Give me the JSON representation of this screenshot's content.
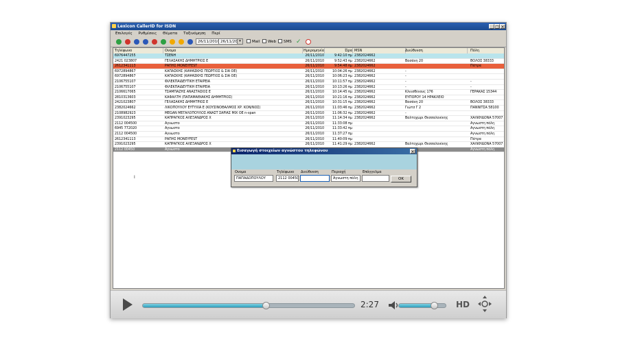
{
  "window": {
    "title": "Lexicon CallerID for ISDN",
    "buttons": {
      "minimize": "_",
      "maximize": "□",
      "close": "×"
    }
  },
  "menu": [
    "Επιλογές",
    "Ρυθμίσεις",
    "Θέματα",
    "Ταξινόμηση",
    "Περί"
  ],
  "toolbar": {
    "date_from": "26/11/2010",
    "date_to": "26/11/2010",
    "checks": [
      "Mail",
      "Web",
      "SMS"
    ],
    "icon_colors": [
      "#2ea043",
      "#d0342c",
      "#2b58b8",
      "#2b58b8",
      "#d0342c",
      "#2ea043",
      "#f2a900",
      "#f2a900",
      "#2b58b8"
    ]
  },
  "table": {
    "columns": [
      "Τηλέφωνο",
      "Ονομα",
      "Ημερομηνία",
      "Ώρα",
      "MSN",
      "Διεύθυνση",
      "Πόλη"
    ],
    "rows": [
      {
        "cells": [
          "6976447255",
          "ΤΣΕΝΗ",
          "26/11/2010",
          "9:42:10 πμ",
          "2382024662",
          "",
          ""
        ],
        "style": "selected"
      },
      {
        "cells": [
          "2421 023807",
          "ΓΕΛΑΣΑΚΗΣ ΔΗΜΗΤΡΙΟΣ Ε",
          "26/11/2010",
          "9:52:43 πμ",
          "2382024662",
          "Βασάνη 20",
          "ΒΟΛΟΣ 38333"
        ],
        "style": ""
      },
      {
        "cells": [
          "2612341113",
          "ΡΑΠΗΣ MONEYFEST",
          "26/11/2010",
          "9:54:48 πμ",
          "2382024662",
          "",
          "Πάτρα"
        ],
        "style": "alert"
      },
      {
        "cells": [
          "6972894867",
          "ΚΑΠΑΣΚΗΣ (ΚΑΨΑΣΚΗΣ ΓΕΩΡΓΙΟΣ & ΣΙΑ ΟΕ)",
          "26/11/2010",
          "10:04:26 πμ",
          "2382024662",
          "-",
          ""
        ],
        "style": ""
      },
      {
        "cells": [
          "6972894867",
          "ΚΑΠΑΣΚΗΣ (ΚΑΨΑΣΚΗΣ ΓΕΩΡΓΙΟΣ & ΣΙΑ ΟΕ)",
          "26/11/2010",
          "10:06:23 πμ",
          "2382024662",
          "-",
          ""
        ],
        "style": ""
      },
      {
        "cells": [
          "2106755107",
          "ΦΙΛΕΚΠΑΙΔΕΥΤΙΚΗ ΕΤΑΙΡΕΙΑ",
          "26/11/2010",
          "10:11:57 πμ",
          "2382024662",
          "-",
          "-"
        ],
        "style": ""
      },
      {
        "cells": [
          "2106755107",
          "ΦΙΛΕΚΠΑΙΔΕΥΤΙΚΗ ΕΤΑΙΡΕΙΑ",
          "26/11/2010",
          "10:13:26 πμ",
          "2382024662",
          "-",
          "-"
        ],
        "style": ""
      },
      {
        "cells": [
          "2106617065",
          "ΤΣΑΜΠΑΖΗΣ ΑΝΑΣΤΑΣΙΟΣ Ε",
          "26/11/2010",
          "10:14:45 πμ",
          "2382024662",
          "Κλεισθένους 176",
          "ΓΕΡΑΚΑΣ 15344"
        ],
        "style": ""
      },
      {
        "cells": [
          "2810313603",
          "ΚΑΦΑΛΤΗ (ΠΑΠΑΜΑΘΙΑΚΗΣ ΔΗΜΗΤΡΙΟΣ)",
          "26/11/2010",
          "10:21:16 πμ",
          "2382024662",
          "ΕΥΠΟΡΟΥ 14 ΗΡΑΚΛΕΙΟ",
          ""
        ],
        "style": ""
      },
      {
        "cells": [
          "2421023807",
          "ΓΕΛΑΣΑΚΗΣ ΔΗΜΗΤΡΙΟΣ Ε",
          "26/11/2010",
          "10:31:15 πμ",
          "2382024662",
          "Βασάνη 20",
          "ΒΟΛΟΣ 38333"
        ],
        "style": ""
      },
      {
        "cells": [
          "2382024662",
          "ΛΙΚΟΠΟΥΛΟΥ ΕΥΤΥΧΙΑ Ε (ΚΟΥΣΙΝΟΘΑΛΜΟΣ ΧΡ. ΚΟΝ/ΝΟΣ)",
          "26/11/2010",
          "11:03:46 πμ",
          "2382024662",
          "Γιώτσ Γ 2",
          "ΠΑΝΝΙΤΣΑ 58100"
        ],
        "style": ""
      },
      {
        "cells": [
          "2108982923",
          "MEGAN ΜΕΓΑΛΟΠΟΥΛΟΣ ΑΝΑΣΤ ΣΑΡΙΑΣ ΜΙΧ ΟΕ  n-span",
          "26/11/2010",
          "11:06:32 πμ",
          "2382024662",
          "-",
          ""
        ],
        "style": ""
      },
      {
        "cells": [
          "2391023295",
          "ΚΑΠΡΑΓΚΟΣ ΑΛΕΞΑΝΔΡΟΣ Χ",
          "26/11/2010",
          "11:14:34 πμ",
          "2382024662",
          "Βαλτοχώρι Θεσσαλονίκης",
          "ΧΑΛΚΗΔΟΝΑ 57007"
        ],
        "style": ""
      },
      {
        "cells": [
          "2112 004500",
          "Αγνωστο",
          "26/11/2010",
          "11:33:08 πμ",
          "",
          "",
          "Αγνωστη πόλη"
        ],
        "style": ""
      },
      {
        "cells": [
          "6945 772020",
          "Αγνωστο",
          "26/11/2010",
          "11:33:42 πμ",
          "",
          "",
          "Αγνωστη πόλη"
        ],
        "style": ""
      },
      {
        "cells": [
          "2112 004500",
          "Αγνωστο",
          "26/11/2010",
          "11:37:27 πμ",
          "",
          "",
          "Αγνωστη πόλη"
        ],
        "style": ""
      },
      {
        "cells": [
          "2612341113",
          "ΡΑΠΗΣ MONEYFEST",
          "26/11/2010",
          "11:40:09 πμ",
          "",
          "",
          "Πάτρα"
        ],
        "style": ""
      },
      {
        "cells": [
          "2391023295",
          "ΚΑΠΡΑΓΚΟΣ ΑΛΕΞΑΝΔΡΟΣ Χ",
          "26/11/2010",
          "11:41:29 πμ",
          "2382024662",
          "Βαλτοχώρι Θεσσαλονίκης",
          "ΧΑΛΚΗΔΟΝΑ 57007"
        ],
        "style": ""
      },
      {
        "cells": [
          "2112 00450",
          "Αγνωστο",
          "",
          "",
          "",
          "",
          "Αγνωστη πόλη"
        ],
        "style": "highlight"
      }
    ]
  },
  "dialog": {
    "title": "Εισαγωγή στοιχείων αγνώστου τηλεφώνου",
    "labels": [
      "Ονομα",
      "Τηλέφωνο",
      "Διεύθυνση",
      "Περιοχή",
      "Επάγγελμα"
    ],
    "values": [
      "ΠΑΠΑΔΟΠΟΥΛΟΥ",
      "2112 004500",
      "",
      "Αγνωστη πόλη",
      ""
    ],
    "ok": "OK"
  },
  "player": {
    "time": "2:27",
    "hd": "HD",
    "progress": 0.58,
    "volume": 0.75
  }
}
